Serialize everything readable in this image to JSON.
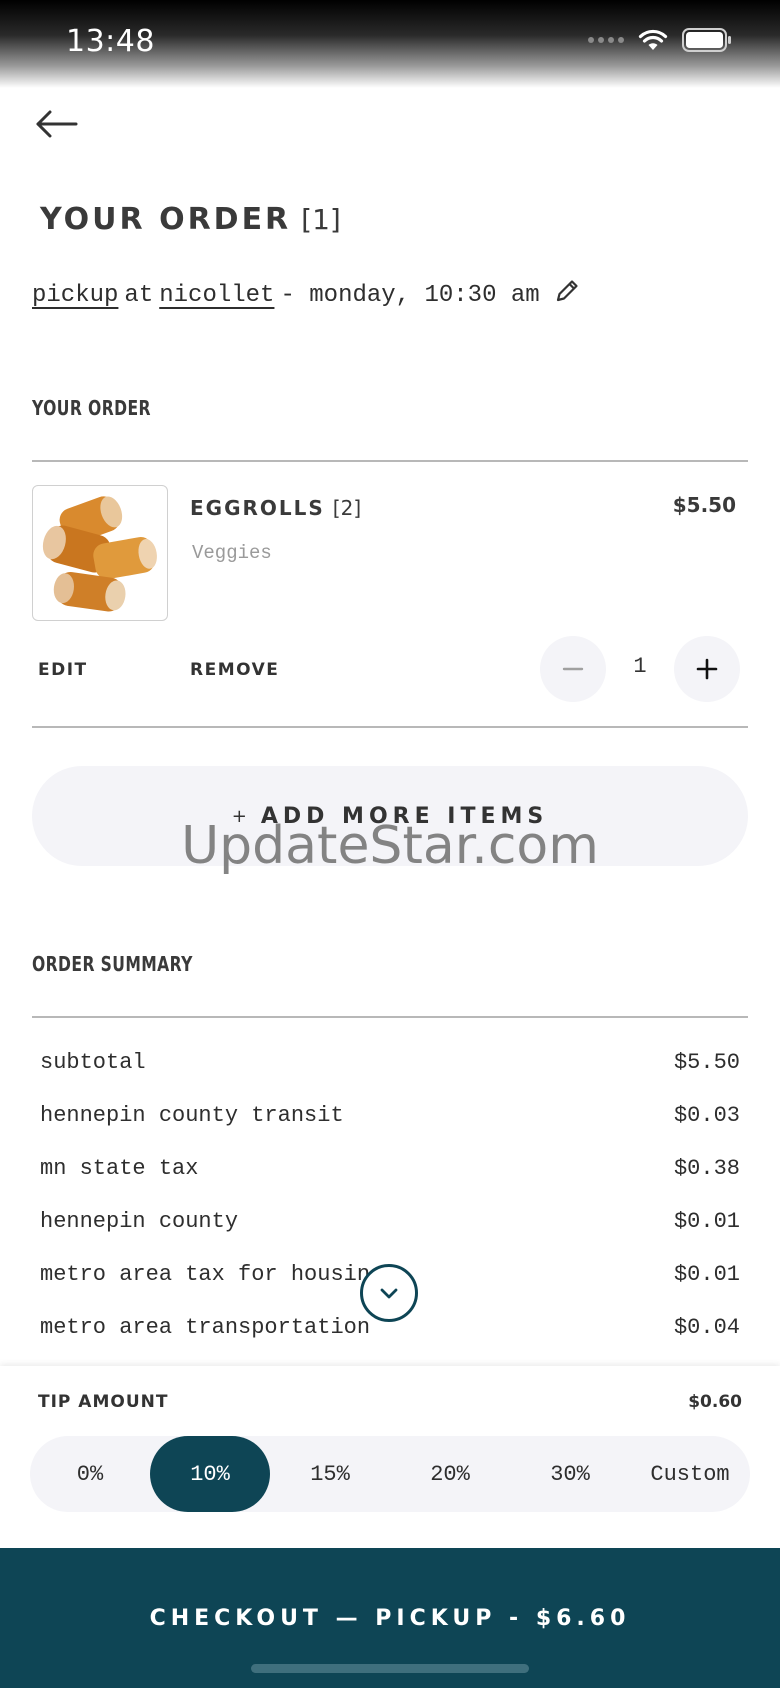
{
  "status_bar": {
    "time": "13:48"
  },
  "header": {
    "title": "YOUR ORDER",
    "title_count": "[1]",
    "pickup": {
      "mode": "pickup",
      "at": "at",
      "location": "nicollet",
      "time": "- monday, 10:30 am"
    }
  },
  "order": {
    "section_label": "YOUR ORDER",
    "items": [
      {
        "name": "EGGROLLS",
        "count": "[2]",
        "subtitle": "Veggies",
        "price": "$5.50",
        "edit_label": "EDIT",
        "remove_label": "REMOVE",
        "quantity": "1"
      }
    ],
    "add_more_label": "ADD MORE ITEMS"
  },
  "watermark": "UpdateStar.com",
  "summary": {
    "section_label": "ORDER SUMMARY",
    "rows": [
      {
        "label": "subtotal",
        "value": "$5.50"
      },
      {
        "label": "hennepin county transit",
        "value": "$0.03"
      },
      {
        "label": "mn state tax",
        "value": "$0.38"
      },
      {
        "label": "hennepin county",
        "value": "$0.01"
      },
      {
        "label": "metro area tax for housing",
        "value": "$0.01"
      },
      {
        "label": "metro area transportation",
        "value": "$0.04"
      }
    ]
  },
  "tip": {
    "label": "TIP AMOUNT",
    "value": "$0.60",
    "options": [
      "0%",
      "10%",
      "15%",
      "20%",
      "30%",
      "Custom"
    ],
    "selected": "10%"
  },
  "checkout": {
    "label": "CHECKOUT — PICKUP - $6.60"
  },
  "colors": {
    "accent": "#0e4555",
    "pill_bg": "#f4f4f8",
    "divider": "#b8b8b8"
  },
  "icons": [
    "back-arrow-icon",
    "pencil-icon",
    "minus-icon",
    "plus-icon",
    "chevron-down-icon",
    "wifi-icon",
    "battery-icon"
  ]
}
